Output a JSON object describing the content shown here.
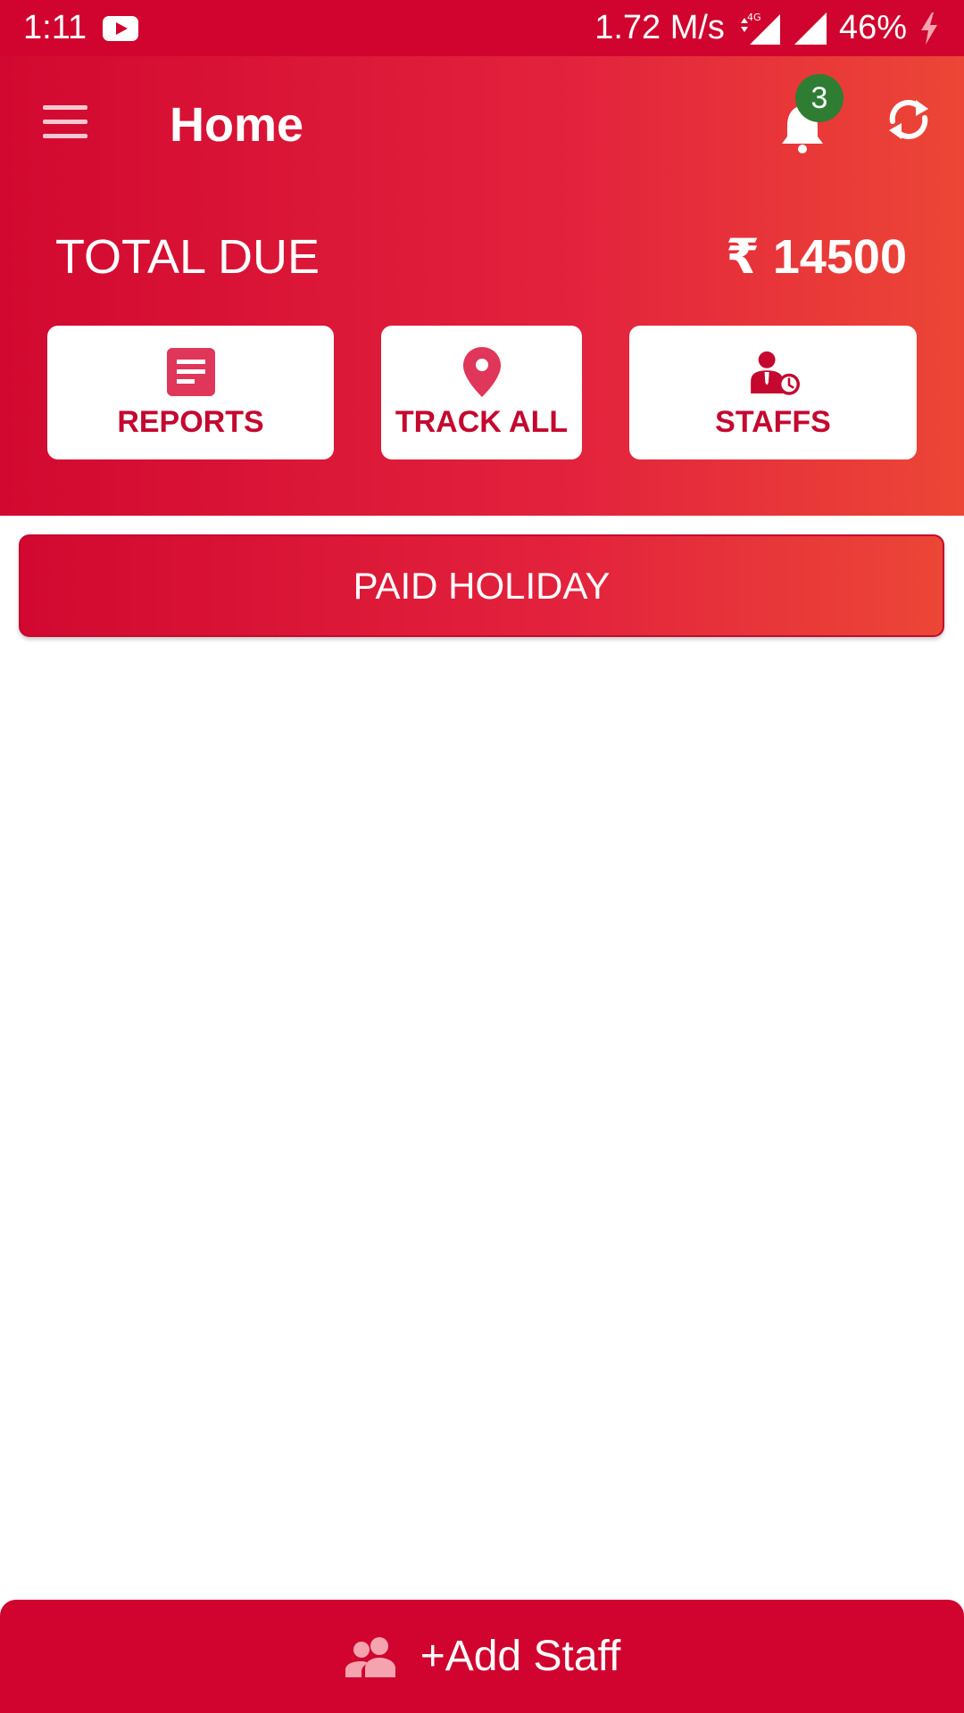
{
  "status_bar": {
    "time": "1:11",
    "network_speed": "1.72 M/s",
    "network_type": "4G",
    "battery": "46%",
    "icons": [
      "youtube-icon",
      "data-arrows-icon",
      "signal-4g-icon",
      "signal-icon",
      "charging-icon"
    ]
  },
  "header": {
    "title": "Home",
    "notification_count": "3",
    "icons": [
      "menu-icon",
      "bell-icon",
      "refresh-icon"
    ]
  },
  "summary": {
    "total_due_label": "TOTAL DUE",
    "total_due_amount": "₹ 14500"
  },
  "actions": [
    {
      "label": "REPORTS",
      "icon": "report-icon"
    },
    {
      "label": "TRACK ALL",
      "icon": "location-pin-icon"
    },
    {
      "label": "STAFFS",
      "icon": "staff-clock-icon"
    }
  ],
  "paid_holiday": {
    "label": "PAID HOLIDAY"
  },
  "bottom_bar": {
    "label": "+Add Staff",
    "icon": "group-icon"
  },
  "colors": {
    "primary": "#d0042e",
    "gradient_start": "#d20830",
    "gradient_end": "#ec4636",
    "card_text": "#c4082f",
    "badge": "#2e7d32"
  }
}
